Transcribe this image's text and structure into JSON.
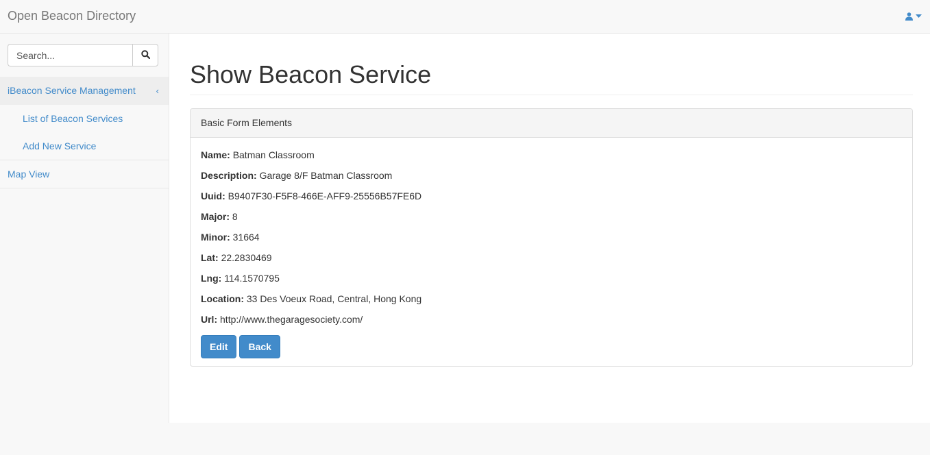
{
  "app": {
    "brand": "Open Beacon Directory"
  },
  "search": {
    "placeholder": "Search..."
  },
  "sidebar": {
    "sections": [
      {
        "label": "iBeacon Service Management",
        "items": [
          {
            "label": "List of Beacon Services"
          },
          {
            "label": "Add New Service"
          }
        ]
      },
      {
        "label": "Map View"
      }
    ]
  },
  "page": {
    "title": "Show Beacon Service"
  },
  "panel": {
    "heading": "Basic Form Elements",
    "fields": [
      {
        "label": "Name:",
        "value": "Batman Classroom"
      },
      {
        "label": "Description:",
        "value": "Garage 8/F Batman Classroom"
      },
      {
        "label": "Uuid:",
        "value": "B9407F30-F5F8-466E-AFF9-25556B57FE6D"
      },
      {
        "label": "Major:",
        "value": "8"
      },
      {
        "label": "Minor:",
        "value": "31664"
      },
      {
        "label": "Lat:",
        "value": "22.2830469"
      },
      {
        "label": "Lng:",
        "value": "114.1570795"
      },
      {
        "label": "Location:",
        "value": "33 Des Voeux Road, Central, Hong Kong"
      },
      {
        "label": "Url:",
        "value": "http://www.thegaragesociety.com/"
      }
    ],
    "buttons": {
      "edit": "Edit",
      "back": "Back"
    }
  },
  "icons": {
    "user": "user-icon",
    "caret": "caret-down-icon",
    "search": "search-icon",
    "chevron": "chevron-left-icon"
  },
  "colors": {
    "link": "#428bca",
    "primary_button": "#428bca"
  }
}
